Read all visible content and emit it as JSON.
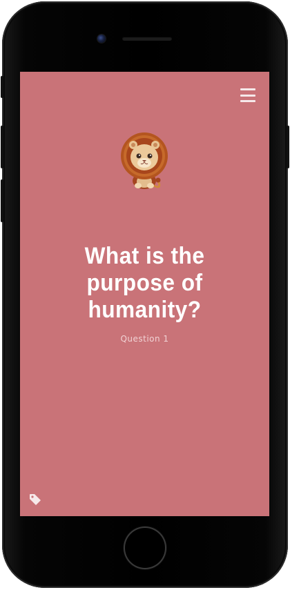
{
  "screen": {
    "background": "#c97378",
    "menu_icon": "hamburger-menu-icon",
    "avatar_icon": "lion-emoji-icon",
    "question": {
      "text": "What is the purpose of humanity?",
      "label": "Question 1"
    },
    "tag_icon": "tag-icon"
  }
}
